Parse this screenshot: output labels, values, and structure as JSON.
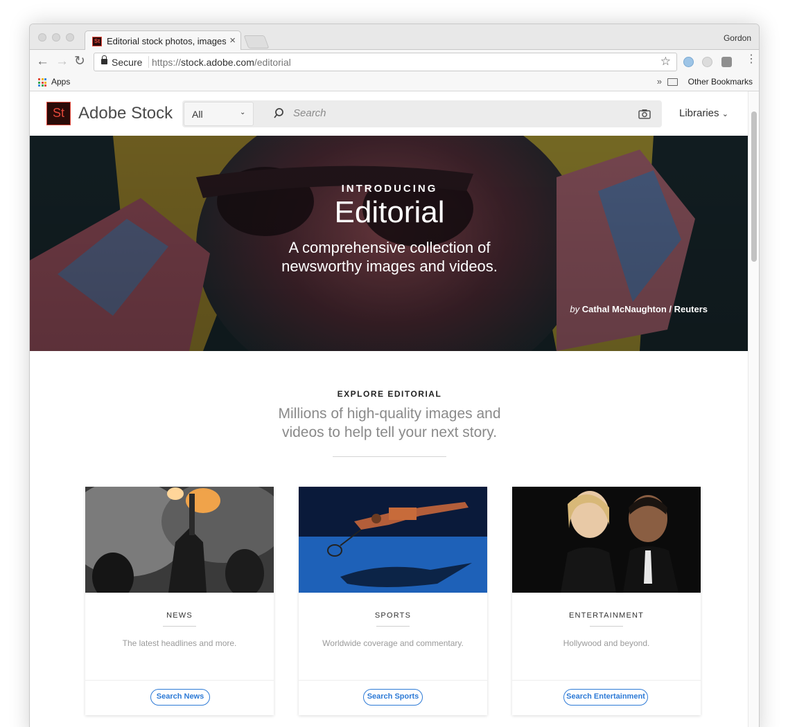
{
  "browser": {
    "tab_title": "Editorial stock photos, images",
    "tab_close": "×",
    "profile_name": "Gordon",
    "secure_label": "Secure",
    "url_scheme": "https://",
    "url_host": "stock.adobe.com",
    "url_path": "/editorial",
    "bookmarks": {
      "apps_label": "Apps",
      "overflow": "»",
      "other": "Other Bookmarks"
    }
  },
  "site": {
    "logo_text": "St",
    "brand": "Adobe Stock",
    "search": {
      "scope": "All",
      "placeholder": "Search"
    },
    "libraries": "Libraries"
  },
  "hero": {
    "kicker": "INTRODUCING",
    "title": "Editorial",
    "subtitle": "A comprehensive collection of newsworthy images and videos.",
    "credit_by": "by",
    "credit_name": "Cathal McNaughton / Reuters"
  },
  "explore": {
    "kicker": "EXPLORE EDITORIAL",
    "subtitle": "Millions of high-quality images and videos to help tell your next story."
  },
  "cards": [
    {
      "title": "NEWS",
      "desc": "The latest headlines and more.",
      "button": "Search News"
    },
    {
      "title": "SPORTS",
      "desc": "Worldwide coverage and commentary.",
      "button": "Search Sports"
    },
    {
      "title": "ENTERTAINMENT",
      "desc": "Hollywood and beyond.",
      "button": "Search Entertainment"
    }
  ],
  "colors": {
    "accent": "#2d7ad6",
    "brand": "#e4483b",
    "logo_bg": "#2a0b08"
  },
  "icons": [
    "back-icon",
    "forward-icon",
    "reload-icon",
    "lock-icon",
    "star-icon",
    "search-icon",
    "camera-icon",
    "chevron-down-icon",
    "folder-icon"
  ]
}
